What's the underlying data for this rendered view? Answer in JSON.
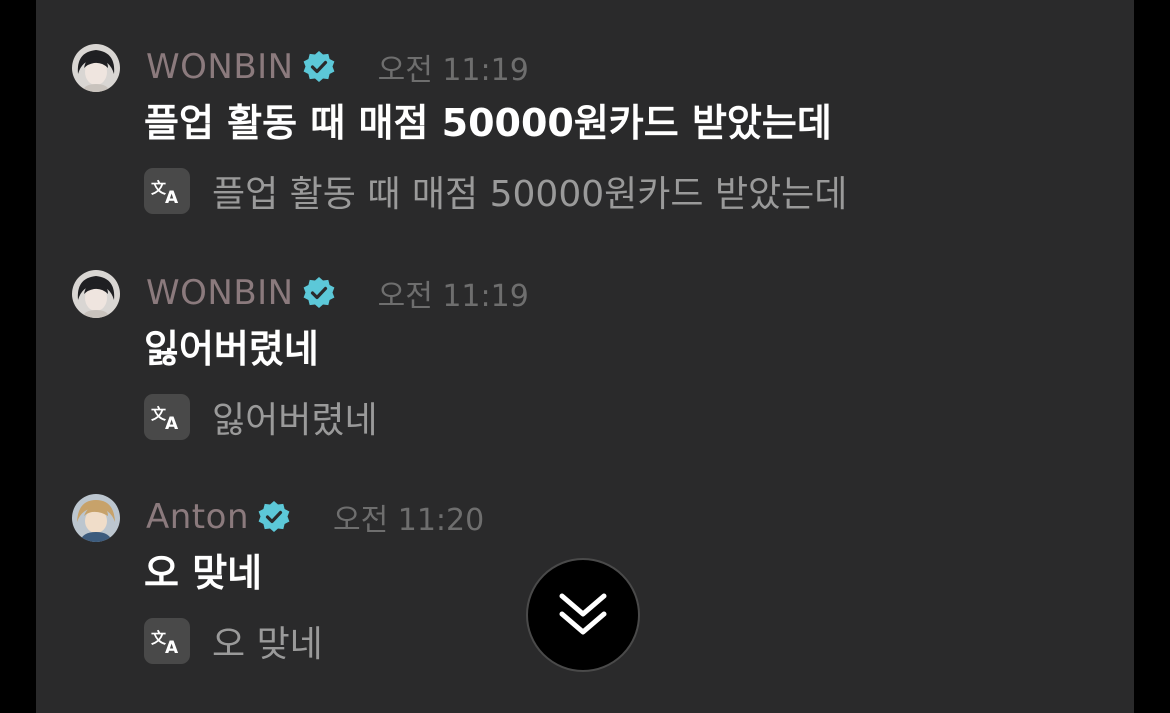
{
  "messages": [
    {
      "author": "WONBIN",
      "time": "오전 11:19",
      "text": "플업 활동 때 매점 50000원카드 받았는데",
      "translation": "플업 활동 때 매점 50000원카드 받았는데",
      "avatar": "dark-hair-avatar"
    },
    {
      "author": "WONBIN",
      "time": "오전 11:19",
      "text": "잃어버렸네",
      "translation": "잃어버렸네",
      "avatar": "dark-hair-avatar"
    },
    {
      "author": "Anton",
      "time": "오전 11:20",
      "text": "오 맞네",
      "translation": "오 맞네",
      "avatar": "light-hair-avatar"
    }
  ],
  "icons": {
    "verified": "verified-badge-icon",
    "translate": "translate-icon",
    "scroll_down": "double-chevron-down-icon"
  },
  "colors": {
    "background": "#2a2a2b",
    "author": "#8b7a7d",
    "verified": "#5cc8d8",
    "timestamp": "#6e6e6e",
    "message": "#ffffff",
    "translation": "#9a9a9a"
  }
}
